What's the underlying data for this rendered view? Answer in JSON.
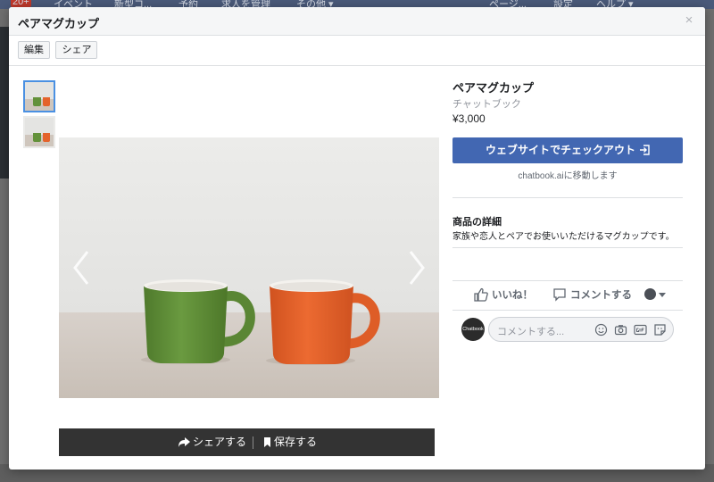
{
  "background": {
    "badge": "20+",
    "nav_items": [
      "イベント",
      "新型コ...",
      "予約",
      "求人を管理",
      "その他 ▾",
      "ページ...",
      "設定",
      "ヘルプ ▾"
    ]
  },
  "modal": {
    "title": "ペアマグカップ",
    "close_glyph": "×",
    "toolbar": {
      "edit_label": "編集",
      "share_label": "シェア"
    }
  },
  "gallery": {
    "thumbnails": [
      {
        "alt": "ペアマグカップ 画像1",
        "active": true
      },
      {
        "alt": "ペアマグカップ 画像2",
        "active": false
      }
    ],
    "prev_icon": "chevron-left-icon",
    "next_icon": "chevron-right-icon",
    "mug_colors": {
      "green": "#64913b",
      "orange": "#e4632c"
    }
  },
  "share_bar": {
    "share_label": "シェアする",
    "save_label": "保存する"
  },
  "product": {
    "name": "ペアマグカップ",
    "seller": "チャットブック",
    "price": "¥3,000",
    "checkout_label": "ウェブサイトでチェックアウト",
    "redirect_note": "chatbook.aiに移動します",
    "details_title": "商品の詳細",
    "details_text": "家族や恋人とペアでお使いいただけるマグカップです。"
  },
  "actions": {
    "like_label": "いいね！",
    "comment_label": "コメントする"
  },
  "comment": {
    "avatar_text": "Chatbook",
    "placeholder": "コメントする..."
  },
  "colors": {
    "accent": "#4267b2",
    "share_bar_bg": "#333333"
  }
}
